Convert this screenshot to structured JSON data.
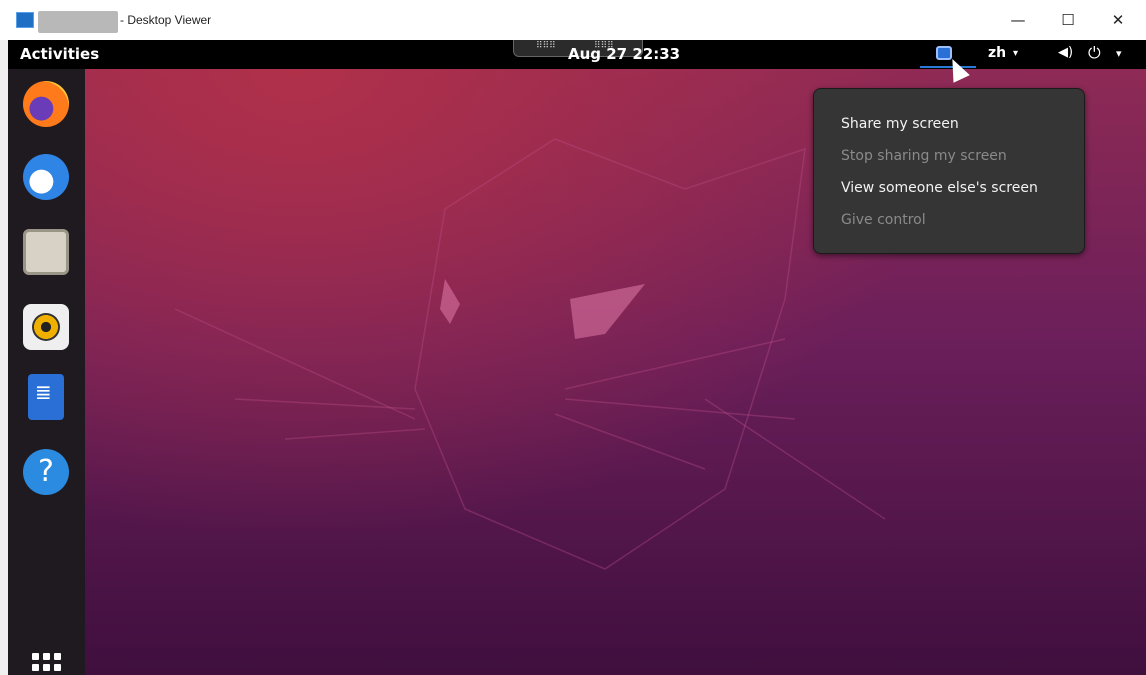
{
  "window": {
    "title": "- Desktop Viewer",
    "controls": {
      "minimize": "—",
      "maximize": "☐",
      "close": "✕"
    }
  },
  "topbar": {
    "activities": "Activities",
    "clock": "Aug 27  22:33",
    "language": "zh",
    "language_caret": "▾",
    "volume_icon": "volume-icon",
    "power_icon": "power-icon",
    "system_caret": "▾"
  },
  "dock": {
    "items": [
      {
        "name": "Firefox",
        "icon": "firefox-icon"
      },
      {
        "name": "Thunderbird",
        "icon": "thunderbird-icon"
      },
      {
        "name": "Files",
        "icon": "files-icon"
      },
      {
        "name": "Rhythmbox",
        "icon": "rhythmbox-icon"
      },
      {
        "name": "LibreOffice Writer",
        "icon": "writer-icon"
      },
      {
        "name": "Help",
        "icon": "help-icon",
        "glyph": "?"
      }
    ],
    "show_apps_icon": "app-grid-icon"
  },
  "screen_share_menu": {
    "items": [
      {
        "label": "Share my screen",
        "enabled": true
      },
      {
        "label": "Stop sharing my screen",
        "enabled": false
      },
      {
        "label": "View someone else's screen",
        "enabled": true
      },
      {
        "label": "Give control",
        "enabled": false
      }
    ]
  },
  "colors": {
    "menu_bg": "#353535",
    "accent": "#2a7ad8",
    "wallpaper_top": "#8e2a55",
    "wallpaper_bottom": "#3f0f3e"
  }
}
